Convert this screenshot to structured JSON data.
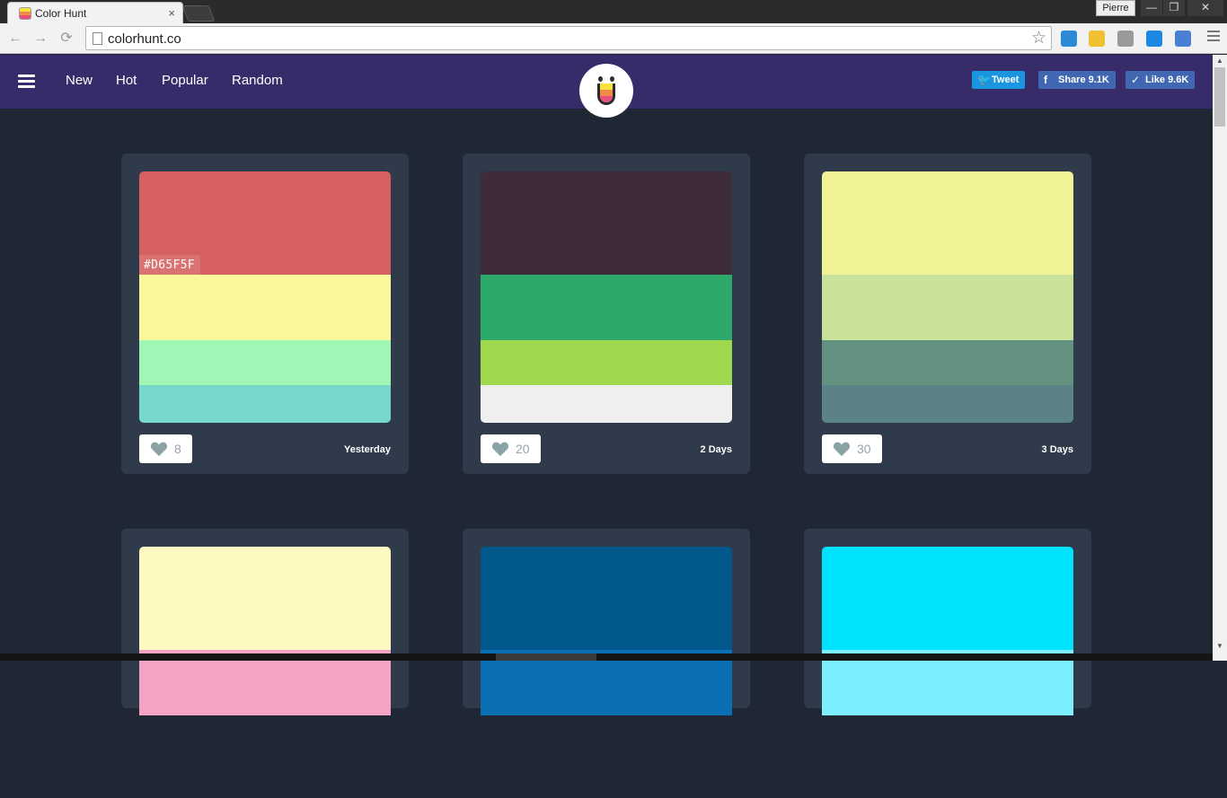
{
  "browser": {
    "tab_title": "Color Hunt",
    "tab_close": "×",
    "profile_name": "Pierre",
    "minimize": "—",
    "restore": "❐",
    "close": "✕",
    "back": "←",
    "forward": "→",
    "reload": "⟳",
    "url": "colorhunt.co",
    "star": "☆",
    "extensions": [
      {
        "name": "extension-a-icon",
        "color": "#2a8ad8"
      },
      {
        "name": "colorhunt-extension-icon",
        "color": "#f0c033"
      },
      {
        "name": "skype-icon",
        "color": "#9a9a9a"
      },
      {
        "name": "s-extension-icon",
        "color": "#1e88e5"
      },
      {
        "name": "google-translate-icon",
        "color": "#4a7fd4"
      }
    ]
  },
  "header": {
    "nav": [
      "New",
      "Hot",
      "Popular",
      "Random"
    ],
    "tweet_label": "Tweet",
    "share_label": "Share 9.1K",
    "like_label": "Like 9.6K",
    "tweet_icon": "🐦",
    "share_icon": "f",
    "like_icon": "✓",
    "logo_colors": [
      "#f5e33b",
      "#f08a45",
      "#e8507b"
    ]
  },
  "cards": [
    {
      "colors": [
        "#D65F5F",
        "#FAF89A",
        "#A0F6B4",
        "#78D7CB"
      ],
      "hex_label": "#D65F5F",
      "likes": "8",
      "date": "Yesterday"
    },
    {
      "colors": [
        "#3E2C3A",
        "#2DAA6B",
        "#A0D84E",
        "#EFEFEF"
      ],
      "hex_label": "",
      "likes": "20",
      "date": "2 Days"
    },
    {
      "colors": [
        "#F1F195",
        "#C9E29B",
        "#629180",
        "#5A8287"
      ],
      "hex_label": "",
      "likes": "30",
      "date": "3 Days"
    },
    {
      "colors": [
        "#FEF9C1",
        "#F4A3C4"
      ],
      "hex_label": "",
      "likes": "",
      "date": ""
    },
    {
      "colors": [
        "#00588C",
        "#0A6FB3"
      ],
      "hex_label": "",
      "likes": "",
      "date": ""
    },
    {
      "colors": [
        "#00E3FF",
        "#7CEFFF"
      ],
      "hex_label": "",
      "likes": "",
      "date": ""
    }
  ]
}
